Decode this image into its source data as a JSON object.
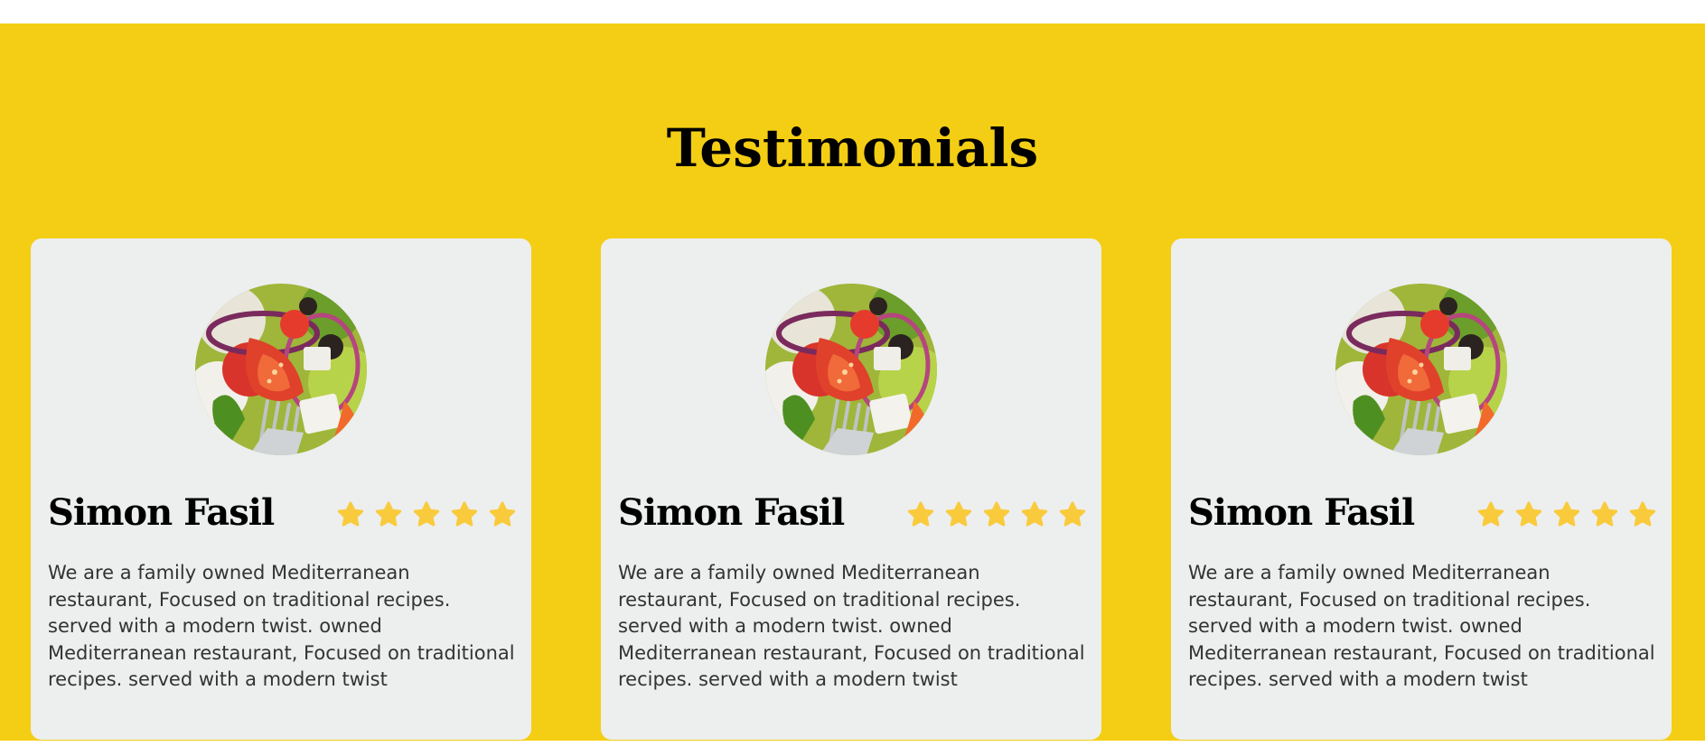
{
  "section": {
    "title": "Testimonials",
    "background_color": "#F4CE14",
    "card_color": "#EDEEEE",
    "star_color": "#F9CB3C"
  },
  "testimonials": [
    {
      "name": "Simon Fasil",
      "rating": 5,
      "rating_max": 5,
      "avatar": "salad-photo",
      "text": "We are a family owned Mediterranean restaurant, Focused on traditional recipes. served with a modern twist. owned Mediterranean restaurant, Focused on traditional recipes. served with a modern twist"
    },
    {
      "name": "Simon Fasil",
      "rating": 5,
      "rating_max": 5,
      "avatar": "salad-photo",
      "text": "We are a family owned Mediterranean restaurant, Focused on traditional recipes. served with a modern twist. owned Mediterranean restaurant, Focused on traditional recipes. served with a modern twist"
    },
    {
      "name": "Simon Fasil",
      "rating": 5,
      "rating_max": 5,
      "avatar": "salad-photo",
      "text": "We are a family owned Mediterranean restaurant, Focused on traditional recipes. served with a modern twist. owned Mediterranean restaurant, Focused on traditional recipes. served with a modern twist"
    }
  ]
}
